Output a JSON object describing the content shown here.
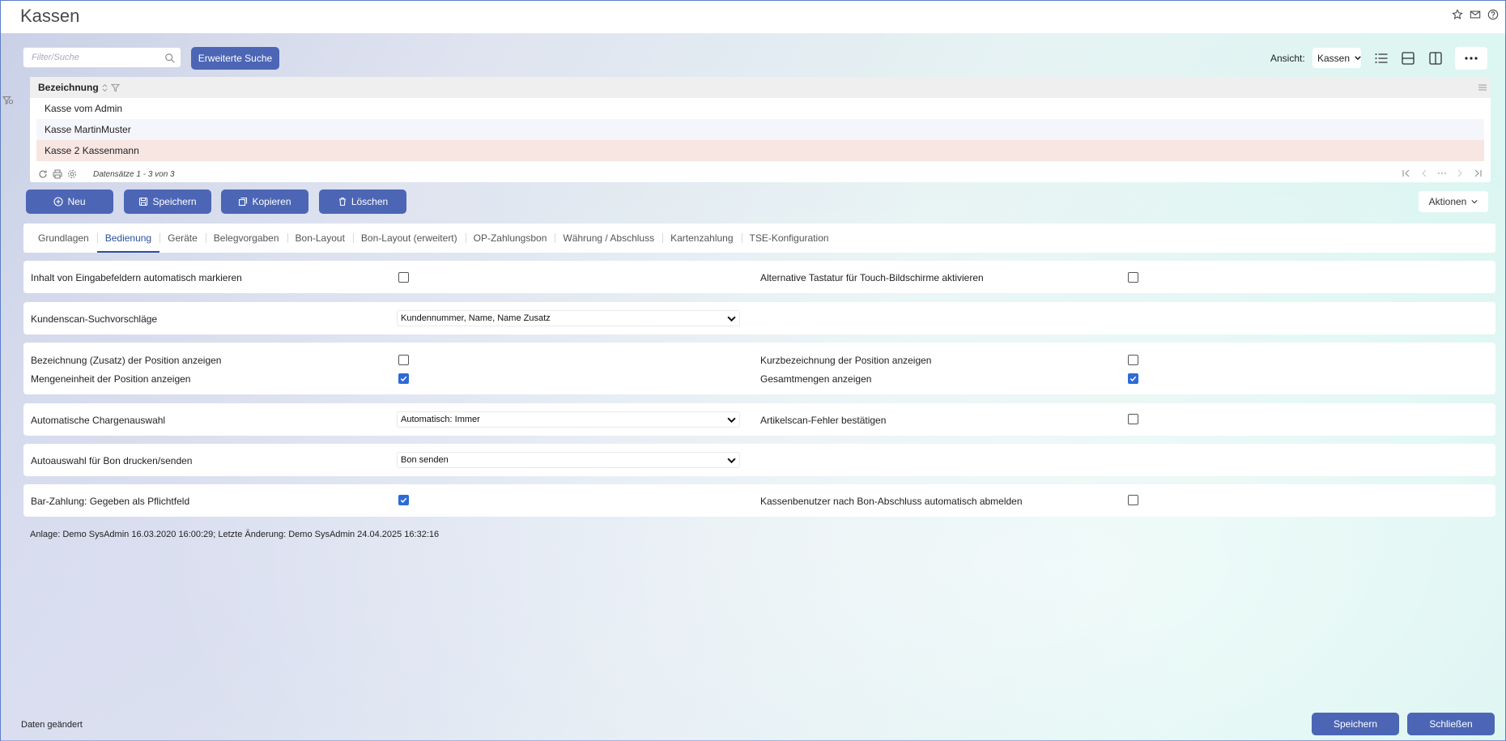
{
  "window": {
    "title": "Kassen"
  },
  "title_icons": [
    "star-icon",
    "mail-icon",
    "help-icon"
  ],
  "search": {
    "placeholder": "Filter/Suche",
    "extended_button": "Erweiterte Suche"
  },
  "view": {
    "label": "Ansicht:",
    "selected": "Kassen"
  },
  "grid": {
    "column_header": "Bezeichnung",
    "rows": [
      "Kasse vom Admin",
      "Kasse MartinMuster",
      "Kasse 2 Kassenmann"
    ],
    "selected_row": 2,
    "records_info": "Datensätze 1 - 3 von 3"
  },
  "actions": {
    "new": "Neu",
    "save": "Speichern",
    "copy": "Kopieren",
    "delete": "Löschen",
    "more": "Aktionen"
  },
  "tabs": [
    "Grundlagen",
    "Bedienung",
    "Geräte",
    "Belegvorgaben",
    "Bon-Layout",
    "Bon-Layout (erweitert)",
    "OP-Zahlungsbon",
    "Währung / Abschluss",
    "Kartenzahlung",
    "TSE-Konfiguration"
  ],
  "active_tab": "Bedienung",
  "settings": {
    "auto_mark": {
      "label": "Inhalt von Eingabefeldern automatisch markieren",
      "checked": false
    },
    "alt_keyboard": {
      "label": "Alternative Tastatur für Touch-Bildschirme aktivieren",
      "checked": false
    },
    "customer_scan": {
      "label": "Kundenscan-Suchvorschläge",
      "value": "Kundennummer, Name, Name Zusatz"
    },
    "show_name_extra": {
      "label": "Bezeichnung (Zusatz) der Position anzeigen",
      "checked": false
    },
    "show_short_name": {
      "label": "Kurzbezeichnung der Position anzeigen",
      "checked": false
    },
    "show_unit": {
      "label": "Mengeneinheit der Position anzeigen",
      "checked": true
    },
    "show_totals": {
      "label": "Gesamtmengen anzeigen",
      "checked": true
    },
    "batch_select": {
      "label": "Automatische Chargenauswahl",
      "value": "Automatisch: Immer"
    },
    "article_scan_error": {
      "label": "Artikelscan-Fehler bestätigen",
      "checked": false
    },
    "receipt_auto": {
      "label": "Autoauswahl für Bon drucken/senden",
      "value": "Bon senden"
    },
    "cash_given_required": {
      "label": "Bar-Zahlung: Gegeben als Pflichtfeld",
      "checked": true
    },
    "auto_logout": {
      "label": "Kassenbenutzer nach Bon-Abschluss automatisch abmelden",
      "checked": false
    }
  },
  "audit": "Anlage: Demo SysAdmin 16.03.2020 16:00:29; Letzte Änderung: Demo SysAdmin 24.04.2025 16:32:16",
  "status": "Daten geändert",
  "footer": {
    "save": "Speichern",
    "close": "Schließen"
  },
  "colors": {
    "primary": "#4c66b5",
    "active_tab": "#2c4fa0",
    "selected_row": "#f8e6e3",
    "checkbox": "#2d6bd6"
  }
}
